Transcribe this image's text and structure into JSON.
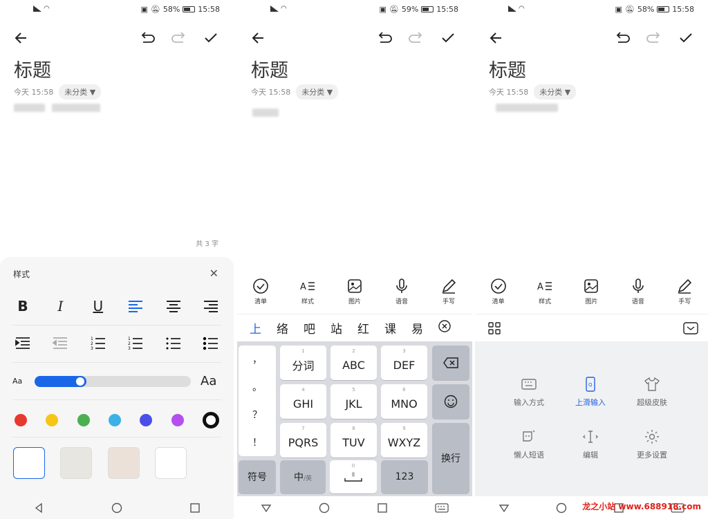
{
  "status": [
    {
      "battery": "58%",
      "time": "15:58"
    },
    {
      "battery": "59%",
      "time": "15:58"
    },
    {
      "battery": "58%",
      "time": "15:58"
    }
  ],
  "note": {
    "title": "标题",
    "date": "今天 15:58",
    "category": "未分类 ▼",
    "count": "共 3 字"
  },
  "style_sheet": {
    "title": "样式",
    "close": "✕",
    "text_formats": [
      "B",
      "I",
      "U"
    ],
    "small_a": "Aa",
    "large_a": "Aa",
    "font_size_level": 0.33,
    "accent": "#1a66e8",
    "colors": [
      "#e8392f",
      "#f5c518",
      "#4caf50",
      "#3bb1e6",
      "#4a4ee8",
      "#b44fef",
      "#111111"
    ],
    "backgrounds": [
      "#ffffff",
      "#e8e6e0",
      "#ebe1d9",
      "#ffffff"
    ]
  },
  "tools": [
    "清单",
    "样式",
    "图片",
    "语音",
    "手写"
  ],
  "candidates": [
    "上",
    "络",
    "吧",
    "站",
    "红",
    "课",
    "易"
  ],
  "punct": [
    "，",
    "。",
    "？",
    "！"
  ],
  "keys": {
    "row1": [
      {
        "sub": "1",
        "main": "分词"
      },
      {
        "sub": "2",
        "main": "ABC"
      },
      {
        "sub": "3",
        "main": "DEF"
      }
    ],
    "row2": [
      {
        "sub": "4",
        "main": "GHI"
      },
      {
        "sub": "5",
        "main": "JKL"
      },
      {
        "sub": "6",
        "main": "MNO"
      }
    ],
    "row3": [
      {
        "sub": "7",
        "main": "PQRS"
      },
      {
        "sub": "8",
        "main": "TUV"
      },
      {
        "sub": "9",
        "main": "WXYZ"
      }
    ],
    "symbols": "符号",
    "chinese": "中",
    "chinese_sub": "/英",
    "zero": "0",
    "num": "123",
    "enter": "换行"
  },
  "ime_menu": [
    {
      "label": "输入方式",
      "icon": "keyboard-icon",
      "active": false
    },
    {
      "label": "上滑输入",
      "icon": "swipe-input-icon",
      "active": true
    },
    {
      "label": "超级皮肤",
      "icon": "tshirt-icon",
      "active": false
    },
    {
      "label": "懒人短语",
      "icon": "phrase-icon",
      "active": false
    },
    {
      "label": "编辑",
      "icon": "cursor-edit-icon",
      "active": false
    },
    {
      "label": "更多设置",
      "icon": "gear-icon",
      "active": false
    }
  ],
  "watermark": "龙之小站  www.688918.com"
}
